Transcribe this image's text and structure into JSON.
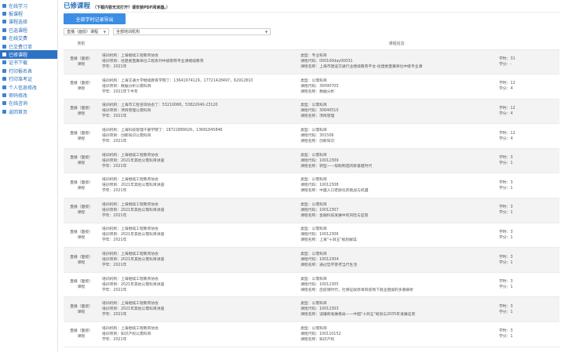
{
  "sidebar": {
    "items": [
      {
        "label": "在线学习",
        "icon": "monitor-icon",
        "active": false
      },
      {
        "label": "报课程",
        "icon": "book-icon",
        "active": false
      },
      {
        "label": "课程选择",
        "icon": "list-icon",
        "active": false
      },
      {
        "label": "已选课程",
        "icon": "bookmark-icon",
        "active": false
      },
      {
        "label": "在线交费",
        "icon": "wallet-icon",
        "active": false
      },
      {
        "label": "已交费订单",
        "icon": "order-icon",
        "active": false
      },
      {
        "label": "已修课程",
        "icon": "check-book-icon",
        "active": true
      },
      {
        "label": "证书下载",
        "icon": "certificate-icon",
        "active": false
      },
      {
        "label": "打印报名表",
        "icon": "printer-icon",
        "active": false
      },
      {
        "label": "打印准考证",
        "icon": "printer-icon",
        "active": false
      },
      {
        "label": "个人信息修改",
        "icon": "user-icon",
        "active": false
      },
      {
        "label": "密码修改",
        "icon": "lock-icon",
        "active": false
      },
      {
        "label": "在线咨询",
        "icon": "chat-icon",
        "active": false
      },
      {
        "label": "返回首页",
        "icon": "home-icon",
        "active": false
      }
    ]
  },
  "header": {
    "title": "已修课程",
    "note": "（下载内容无法打开？请安装PDF阅读器。）"
  },
  "toolbar": {
    "export_label": "全部学时记录导出"
  },
  "filters": {
    "type_value": "直播（面授）课程",
    "org_value": "全部培训机构"
  },
  "table": {
    "columns": [
      "类别",
      "",
      "课程信息",
      ""
    ],
    "rows": [
      {
        "type": [
          "直播（面授）",
          "课程"
        ],
        "org": [
          "培训机构：上海继续工程教育协会",
          "培训项目：住建委直属单位工程系列中级职称专业课继续教育",
          "学年：2021年"
        ],
        "course": [
          "类型：专业科目",
          "课程代码：000100day00031",
          "课程名称：上海市建设交通行业继续教育平台-住建委直属单位中级专业课"
        ],
        "hours": [
          "学时：31",
          "学分：-"
        ]
      },
      {
        "type": [
          "直播（面授）",
          "课程"
        ],
        "org": [
          "培训机构：上海交通大学继续教育学院丁：13641974129，17721428497，62912810",
          "培训项目：数据分析公需科目",
          "学年：2021年下半年"
        ],
        "course": [
          "类型：公需科目",
          "课程代码：30090705",
          "课程名称：数据分析"
        ],
        "hours": [
          "学时：12",
          "学分：4"
        ]
      },
      {
        "type": [
          "直播（面授）",
          "课程"
        ],
        "org": [
          "培训机构：上海市工程咨询协会丁：53210068，53822040-23120",
          "培训项目：项目管理公需科目",
          "学年：2021年"
        ],
        "course": [
          "类型：公需科目",
          "课程代码：30640510",
          "课程名称：项目管理"
        ],
        "hours": [
          "学时：12",
          "学分：4"
        ]
      },
      {
        "type": [
          "直播（面授）",
          "课程"
        ],
        "org": [
          "培训机构：上海科技管理干部学院丁：18721889026，13681845846",
          "培训项目：创新知识公需科目",
          "学年：2021年"
        ],
        "course": [
          "类型：公需科目",
          "课程代码：301506",
          "课程名称：创新知识"
        ],
        "hours": [
          "学时：12",
          "学分：4"
        ]
      },
      {
        "type": [
          "直播（面授）",
          "课程"
        ],
        "org": [
          "培训机构：上海继续工程教育协会",
          "培训项目：2021年其他公需科目讲座",
          "学年：2021年"
        ],
        "course": [
          "类型：公需科目",
          "课程代码：10012309",
          "课程名称：转型——帮助制造的新基建时代"
        ],
        "hours": [
          "学时：3",
          "学分：1"
        ]
      },
      {
        "type": [
          "直播（面授）",
          "课程"
        ],
        "org": [
          "培训机构：上海继续工程教育协会",
          "培训项目：2021年其他公需科目讲座",
          "学年：2021年"
        ],
        "course": [
          "类型：公需科目",
          "课程代码：10012308",
          "课程名称：中国人口老龄化的挑战与机遇"
        ],
        "hours": [
          "学时：3",
          "学分：1"
        ]
      },
      {
        "type": [
          "直播（面授）",
          "课程"
        ],
        "org": [
          "培训机构：上海继续工程教育协会",
          "培训项目：2021年其他公需科目讲座",
          "学年：2021年"
        ],
        "course": [
          "类型：公需科目",
          "课程代码：10012307",
          "课程名称：金融科技发展中的风险与监管"
        ],
        "hours": [
          "学时：3",
          "学分：1"
        ]
      },
      {
        "type": [
          "直播（面授）",
          "课程"
        ],
        "org": [
          "培训机构：上海继续工程教育协会",
          "培训项目：2021年其他公需科目讲座",
          "学年：2021年"
        ],
        "course": [
          "类型：公需科目",
          "课程代码：10012306",
          "课程名称：上海\"十四五\"规划解读"
        ],
        "hours": [
          "学时：3",
          "学分：1"
        ]
      },
      {
        "type": [
          "直播（面授）",
          "课程"
        ],
        "org": [
          "培训机构：上海继续工程教育协会",
          "培训项目：2021年其他公需科目讲座",
          "学年：2021年"
        ],
        "course": [
          "类型：公需科目",
          "课程代码：10012304",
          "课程名称：通过哲学思考当代生活"
        ],
        "hours": [
          "学时：3",
          "学分：1"
        ]
      },
      {
        "type": [
          "直播（面授）",
          "课程"
        ],
        "org": [
          "培训机构：上海继续工程教育协会",
          "培训项目：2021年其他公需科目讲座",
          "学年：2021年"
        ],
        "course": [
          "类型：公需科目",
          "课程代码：10012305",
          "课程名称：后疫情时代，社保征收改革和疫情下就业困境的多重解析"
        ],
        "hours": [
          "学时：3",
          "学分：1"
        ]
      },
      {
        "type": [
          "直播（面授）",
          "课程"
        ],
        "org": [
          "培训机构：上海继续工程教育协会",
          "培训项目：2021年其他公需科目讲座",
          "学年：2021年"
        ],
        "course": [
          "类型：公需科目",
          "课程代码：10012303",
          "课程名称：读懂新发展格局——中国\"十四五\"规划与2035年发展远景"
        ],
        "hours": [
          "学时：3",
          "学分：1"
        ]
      },
      {
        "type": [
          "直播（面授）",
          "课程"
        ],
        "org": [
          "培训机构：上海继续工程教育协会",
          "培训项目：知识产权公需科目",
          "学年：2021年"
        ],
        "course": [
          "类型：公需科目",
          "课程代码：100110152",
          "课程名称：知识产权"
        ],
        "hours": [
          "学时：3",
          "学分：1"
        ]
      }
    ]
  }
}
